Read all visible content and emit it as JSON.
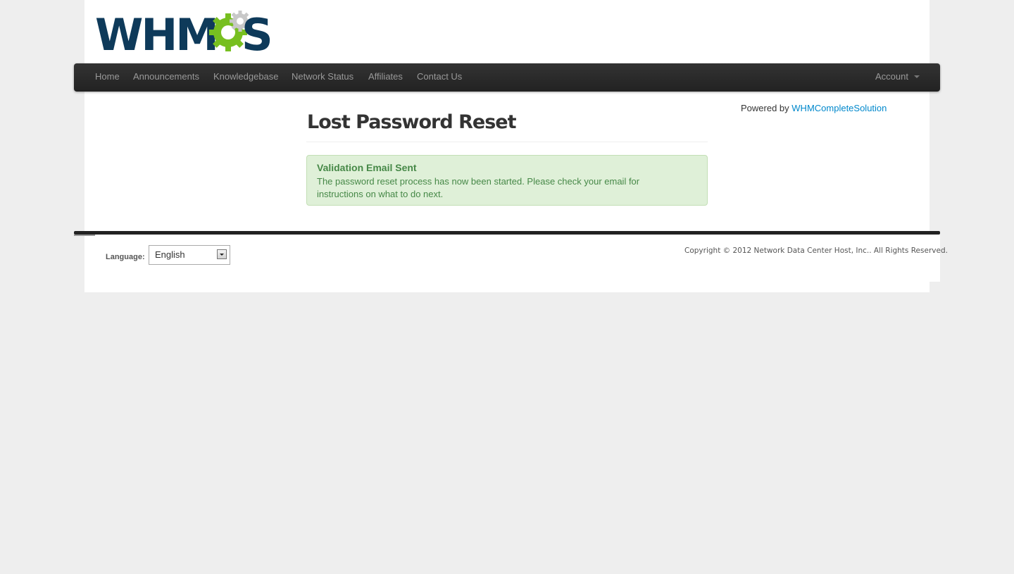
{
  "brand": {
    "logo_text": "WHMCS",
    "colors": {
      "dark": "#0e3a5a",
      "green": "#77bf20",
      "gray": "#c8c8c8"
    }
  },
  "navbar": {
    "items": [
      {
        "label": "Home"
      },
      {
        "label": "Announcements"
      },
      {
        "label": "Knowledgebase"
      },
      {
        "label": "Network Status"
      },
      {
        "label": "Affiliates"
      },
      {
        "label": "Contact Us"
      }
    ],
    "account_label": "Account"
  },
  "main": {
    "title": "Lost Password Reset",
    "alert": {
      "title": "Validation Email Sent",
      "body": "The password reset process has now been started. Please check your email for instructions on what to do next."
    }
  },
  "sidebar": {
    "powered_prefix": "Powered by",
    "powered_link": "WHMCompleteSolution"
  },
  "footer": {
    "language_label": "Language:",
    "language_value": "English",
    "copyright": "Copyright © 2012 Network Data Center Host, Inc.. All Rights Reserved."
  }
}
